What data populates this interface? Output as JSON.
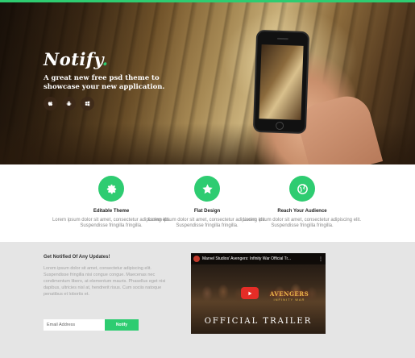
{
  "hero": {
    "brand": "Notify",
    "brand_dot": ".",
    "tagline": "A great new free psd theme to showcase your new application.",
    "store_icons": [
      "apple-icon",
      "android-icon",
      "windows-icon"
    ]
  },
  "features": [
    {
      "icon": "gear-icon",
      "title": "Editable Theme",
      "desc": "Lorem ipsum dolor sit amet, consectetur adipiscing elit. Suspendisse fringilla fringilla."
    },
    {
      "icon": "star-icon",
      "title": "Flat Design",
      "desc": "Lorem ipsum dolor sit amet, consectetur adipiscing elit. Suspendisse fringilla fringilla."
    },
    {
      "icon": "globe-icon",
      "title": "Reach Your Audience",
      "desc": "Lorem ipsum dolor sit amet, consectetur adipiscing elit. Suspendisse fringilla fringilla."
    }
  ],
  "notify": {
    "title": "Get Notified Of Any Updates!",
    "text": "Lorem ipsum dolor sit amet, consectetur adipiscing elit. Suspendisse fringilla nisi congue congue. Maecenas nec condimentum libero, at elementum mauris. Phasellus eget nisi dapibus, ultricies nisl at, hendrerit risus. Cum sociis natoque penatibus et lobortis et.",
    "email_placeholder": "Email Address",
    "button_label": "Notify"
  },
  "video": {
    "title": "Marvel Studios' Avengers: Infinity War Official Tr...",
    "logo": "AVENGERS",
    "logo_sub": "INFINITY WAR",
    "caption": "OFFICIAL TRAILER"
  },
  "colors": {
    "accent": "#2ecc71",
    "bottom_bg": "#e5e5e5"
  }
}
